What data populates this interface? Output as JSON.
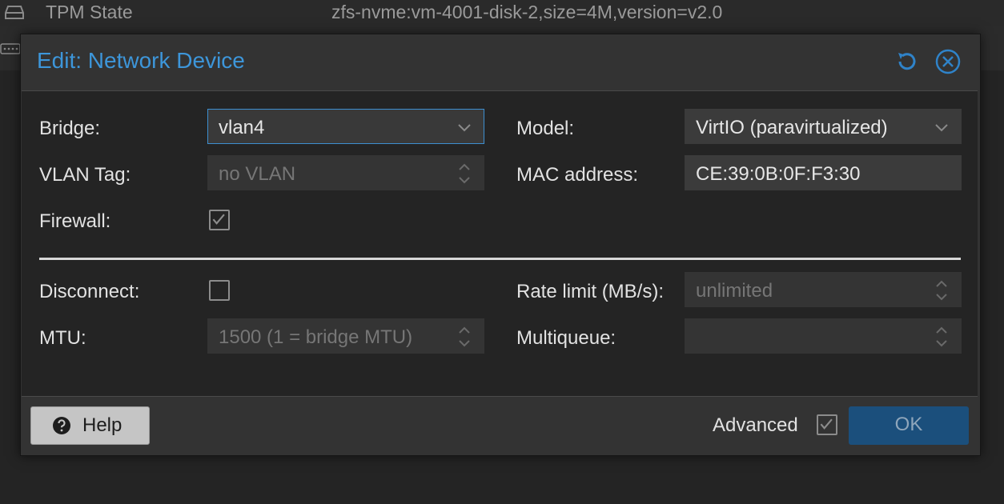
{
  "background": {
    "row1": {
      "name": "TPM State",
      "value": "zfs-nvme:vm-4001-disk-2,size=4M,version=v2.0",
      "icon": "hdd-icon"
    },
    "row2": {
      "icon": "network-card-icon"
    }
  },
  "dialog": {
    "title": "Edit: Network Device",
    "reset_icon": "reset-icon",
    "close_icon": "close-icon"
  },
  "form": {
    "bridge": {
      "label": "Bridge:",
      "value": "vlan4"
    },
    "vlan_tag": {
      "label": "VLAN Tag:",
      "placeholder": "no VLAN"
    },
    "firewall": {
      "label": "Firewall:",
      "checked": true
    },
    "model": {
      "label": "Model:",
      "value": "VirtIO (paravirtualized)"
    },
    "mac": {
      "label": "MAC address:",
      "value": "CE:39:0B:0F:F3:30"
    },
    "disconnect": {
      "label": "Disconnect:",
      "checked": false
    },
    "mtu": {
      "label": "MTU:",
      "placeholder": "1500 (1 = bridge MTU)"
    },
    "rate_limit": {
      "label": "Rate limit (MB/s):",
      "placeholder": "unlimited"
    },
    "multiqueue": {
      "label": "Multiqueue:",
      "value": ""
    }
  },
  "footer": {
    "help_label": "Help",
    "advanced_label": "Advanced",
    "advanced_checked": true,
    "ok_label": "OK"
  },
  "colors": {
    "accent": "#3d96da",
    "ok_button": "#1b4f7c",
    "dialog_bg": "#333333",
    "body_bg": "#242424"
  }
}
